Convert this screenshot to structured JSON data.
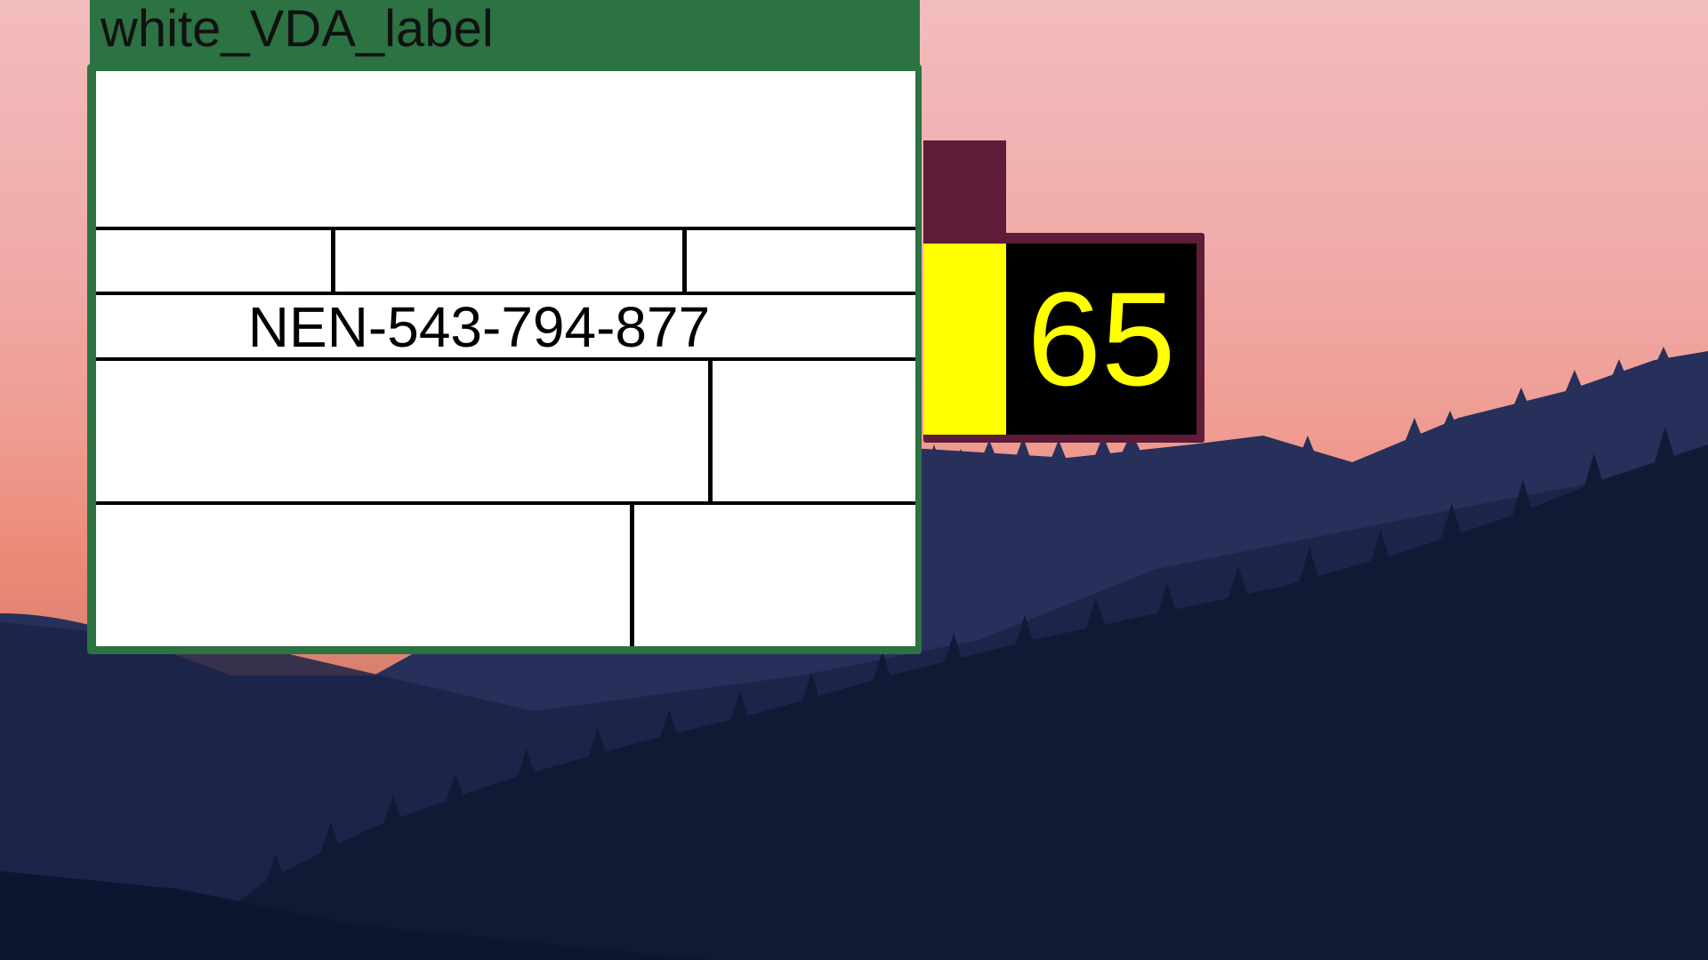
{
  "window": {
    "title": "white_VDA_label"
  },
  "label": {
    "code": "NEN-543-794-877"
  },
  "counter": {
    "value": "65"
  },
  "colors": {
    "window_green": "#2c7242",
    "counter_maroon": "#5d1c37",
    "counter_yellow": "#ffff00",
    "counter_black": "#000000"
  },
  "icons": {
    "wallpaper": "mountain-sunset-wallpaper"
  }
}
